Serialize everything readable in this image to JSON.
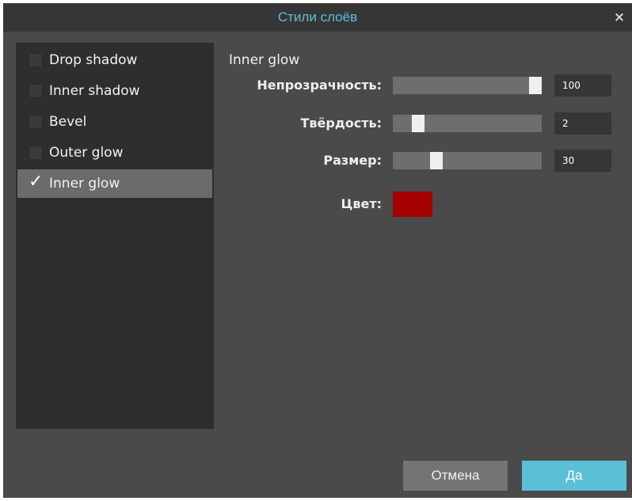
{
  "dialog": {
    "title": "Стили слоёв",
    "close_label": "×"
  },
  "sidebar": {
    "items": [
      {
        "label": "Drop shadow",
        "checked": false,
        "selected": false
      },
      {
        "label": "Inner shadow",
        "checked": false,
        "selected": false
      },
      {
        "label": "Bevel",
        "checked": false,
        "selected": false
      },
      {
        "label": "Outer glow",
        "checked": false,
        "selected": false
      },
      {
        "label": "Inner glow",
        "checked": true,
        "selected": true
      }
    ],
    "check_glyph": "✓"
  },
  "panel": {
    "title": "Inner glow",
    "opacity": {
      "label": "Непрозрачность:",
      "value": "100",
      "fraction": 1.0
    },
    "hardness": {
      "label": "Твёрдость:",
      "value": "2",
      "fraction": 0.17
    },
    "size": {
      "label": "Размер:",
      "value": "30",
      "fraction": 0.29
    },
    "color": {
      "label": "Цвет:",
      "value": "#a40000"
    }
  },
  "buttons": {
    "cancel": "Отмена",
    "ok": "Да"
  },
  "colors": {
    "accent": "#5bbfd6",
    "background": "#4a4a4a",
    "sidebar": "#2e2e2e",
    "selected": "#6b6b6b"
  }
}
